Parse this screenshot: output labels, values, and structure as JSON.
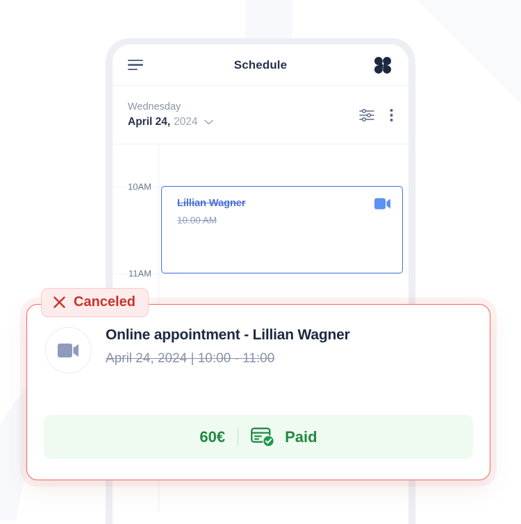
{
  "app": {
    "header": {
      "menu_icon": "hamburger-icon",
      "title": "Schedule",
      "logo_icon": "brand-logo-icon"
    },
    "date_bar": {
      "weekday": "Wednesday",
      "date_bold": "April 24,",
      "date_year": "2024",
      "chevron_icon": "chevron-down-icon",
      "filter_icon": "filter-sliders-icon",
      "more_icon": "more-vertical-icon"
    },
    "calendar": {
      "hours": [
        "10AM",
        "11AM"
      ],
      "event": {
        "name": "Lillian Wagner",
        "time": "10.00 AM",
        "video_icon": "video-camera-icon",
        "accent_color": "#3b6ee8",
        "canceled": true
      }
    }
  },
  "detail_card": {
    "status_badge": {
      "icon": "close-x-icon",
      "label": "Canceled",
      "color": "#c8322c",
      "background": "#fdeceb"
    },
    "avatar_icon": "video-camera-icon",
    "title": "Online appointment - Lillian Wagner",
    "subtitle": "April 24, 2024 | 10:00 - 11:00",
    "payment": {
      "price": "60€",
      "card_icon": "credit-card-check-icon",
      "status_label": "Paid",
      "color": "#1f8a42",
      "background": "#effaf1"
    },
    "border_color": "#f4635e"
  }
}
